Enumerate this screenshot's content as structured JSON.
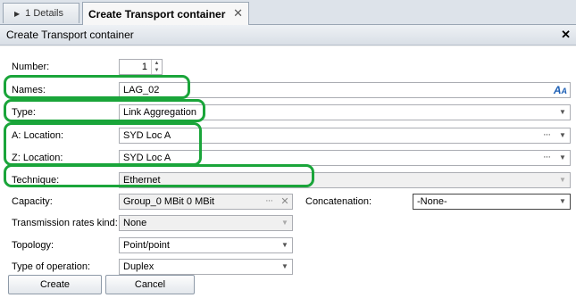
{
  "tabs": [
    {
      "label": "1 Details"
    },
    {
      "label": "Create Transport container"
    }
  ],
  "dialog": {
    "title": "Create Transport container"
  },
  "form": {
    "number": {
      "label": "Number:",
      "value": "1"
    },
    "names": {
      "label": "Names:",
      "value": "LAG_02"
    },
    "type": {
      "label": "Type:",
      "value": "Link Aggregation"
    },
    "a_location": {
      "label": "A: Location:",
      "value": "SYD Loc A"
    },
    "z_location": {
      "label": "Z: Location:",
      "value": "SYD Loc A"
    },
    "technique": {
      "label": "Technique:",
      "value": "Ethernet"
    },
    "capacity": {
      "label": "Capacity:",
      "value": "Group_0 MBit 0 MBit"
    },
    "concatenation": {
      "label": "Concatenation:",
      "value": "-None-"
    },
    "transmission_rates_kind": {
      "label": "Transmission rates kind:",
      "value": "None"
    },
    "topology": {
      "label": "Topology:",
      "value": "Point/point"
    },
    "type_of_operation": {
      "label": "Type of operation:",
      "value": "Duplex"
    }
  },
  "buttons": {
    "create": "Create",
    "cancel": "Cancel"
  },
  "highlight_color": "#1aa53a"
}
